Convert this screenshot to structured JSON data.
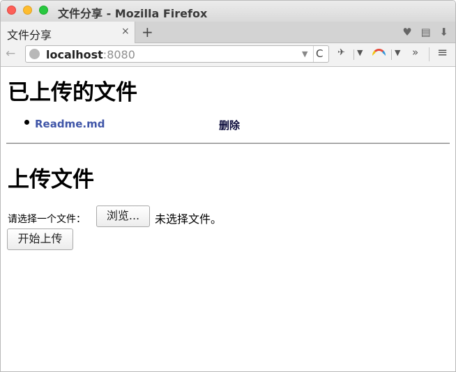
{
  "window": {
    "title": "文件分享 - Mozilla Firefox"
  },
  "tabs": [
    {
      "label": "文件分享",
      "close": "×"
    }
  ],
  "new_tab": "+",
  "tab_tools": "♥ ▤ ⬇",
  "nav": {
    "back": "←",
    "url_host": "localhost",
    "url_port": ":8080",
    "dropdown": "▼",
    "reload": "C",
    "more": "»",
    "menu": "≡"
  },
  "page": {
    "uploaded_heading": "已上传的文件",
    "files": [
      {
        "name": "Readme.md",
        "delete_label": "删除"
      }
    ],
    "upload_heading": "上传文件",
    "choose_label": "请选择一个文件：",
    "browse_label": "浏览...",
    "no_file_text": "未选择文件。",
    "start_label": "开始上传"
  },
  "colors": {
    "link": "#4056a8",
    "delete": "#0a0a3a"
  }
}
